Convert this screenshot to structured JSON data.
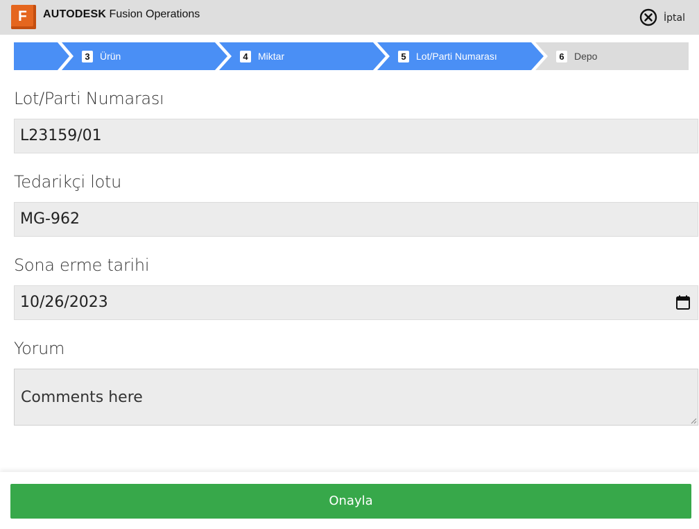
{
  "header": {
    "logo_letter": "F",
    "brand_bold": "AUTODESK",
    "brand_product": "Fusion Operations",
    "cancel_label": "İptal",
    "logo_color": "#e5661e",
    "cancel_icon": "close-circle-icon"
  },
  "stepper": {
    "steps": [
      {
        "number": "",
        "label": "",
        "state": "active"
      },
      {
        "number": "3",
        "label": "Ürün",
        "state": "active"
      },
      {
        "number": "4",
        "label": "Miktar",
        "state": "active"
      },
      {
        "number": "5",
        "label": "Lot/Parti Numarası",
        "state": "active"
      },
      {
        "number": "6",
        "label": "Depo",
        "state": "inactive"
      }
    ],
    "active_color": "#4a8ff5",
    "inactive_color": "#dcdcdc"
  },
  "form": {
    "lot": {
      "label": "Lot/Parti Numarası",
      "value": "L23159/01"
    },
    "supplier_lot": {
      "label": "Tedarikçi lotu",
      "value": "MG-962"
    },
    "expiry": {
      "label": "Sona erme tarihi",
      "value": "10/26/2023",
      "icon": "calendar-icon"
    },
    "comment": {
      "label": "Yorum",
      "placeholder": "Comments here"
    }
  },
  "footer": {
    "confirm_label": "Onayla",
    "confirm_color": "#37a84a"
  }
}
